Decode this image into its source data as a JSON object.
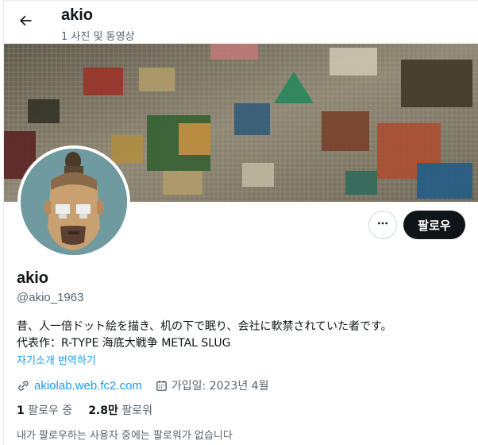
{
  "header": {
    "title": "akio",
    "subtitle": "1 사진 및 동영상",
    "back_icon": "arrow-left-icon"
  },
  "profile": {
    "name": "akio",
    "handle": "@akio_1963",
    "bio_line1": "昔、人一倍ドット絵を描き、机の下で眠り、会社に軟禁されていた者です。",
    "bio_line2": "代表作：R-TYPE 海底大戦争 METAL SLUG",
    "translate_label": "자기소개 번역하기",
    "website": "akiolab.web.fc2.com",
    "joined": "가입일: 2023년 4월"
  },
  "actions": {
    "more_icon": "more-dots-icon",
    "follow_label": "팔로우"
  },
  "stats": {
    "following_count": "1",
    "following_label": "팔로우 중",
    "followers_count": "2.8만",
    "followers_label": "팔로워"
  },
  "followers_you_know": "내가 팔로우하는 사용자 중에는 팔로워가 없습니다",
  "colors": {
    "accent": "#1d9bf0",
    "follow_button": "#0f1419",
    "muted_text": "#536471"
  }
}
